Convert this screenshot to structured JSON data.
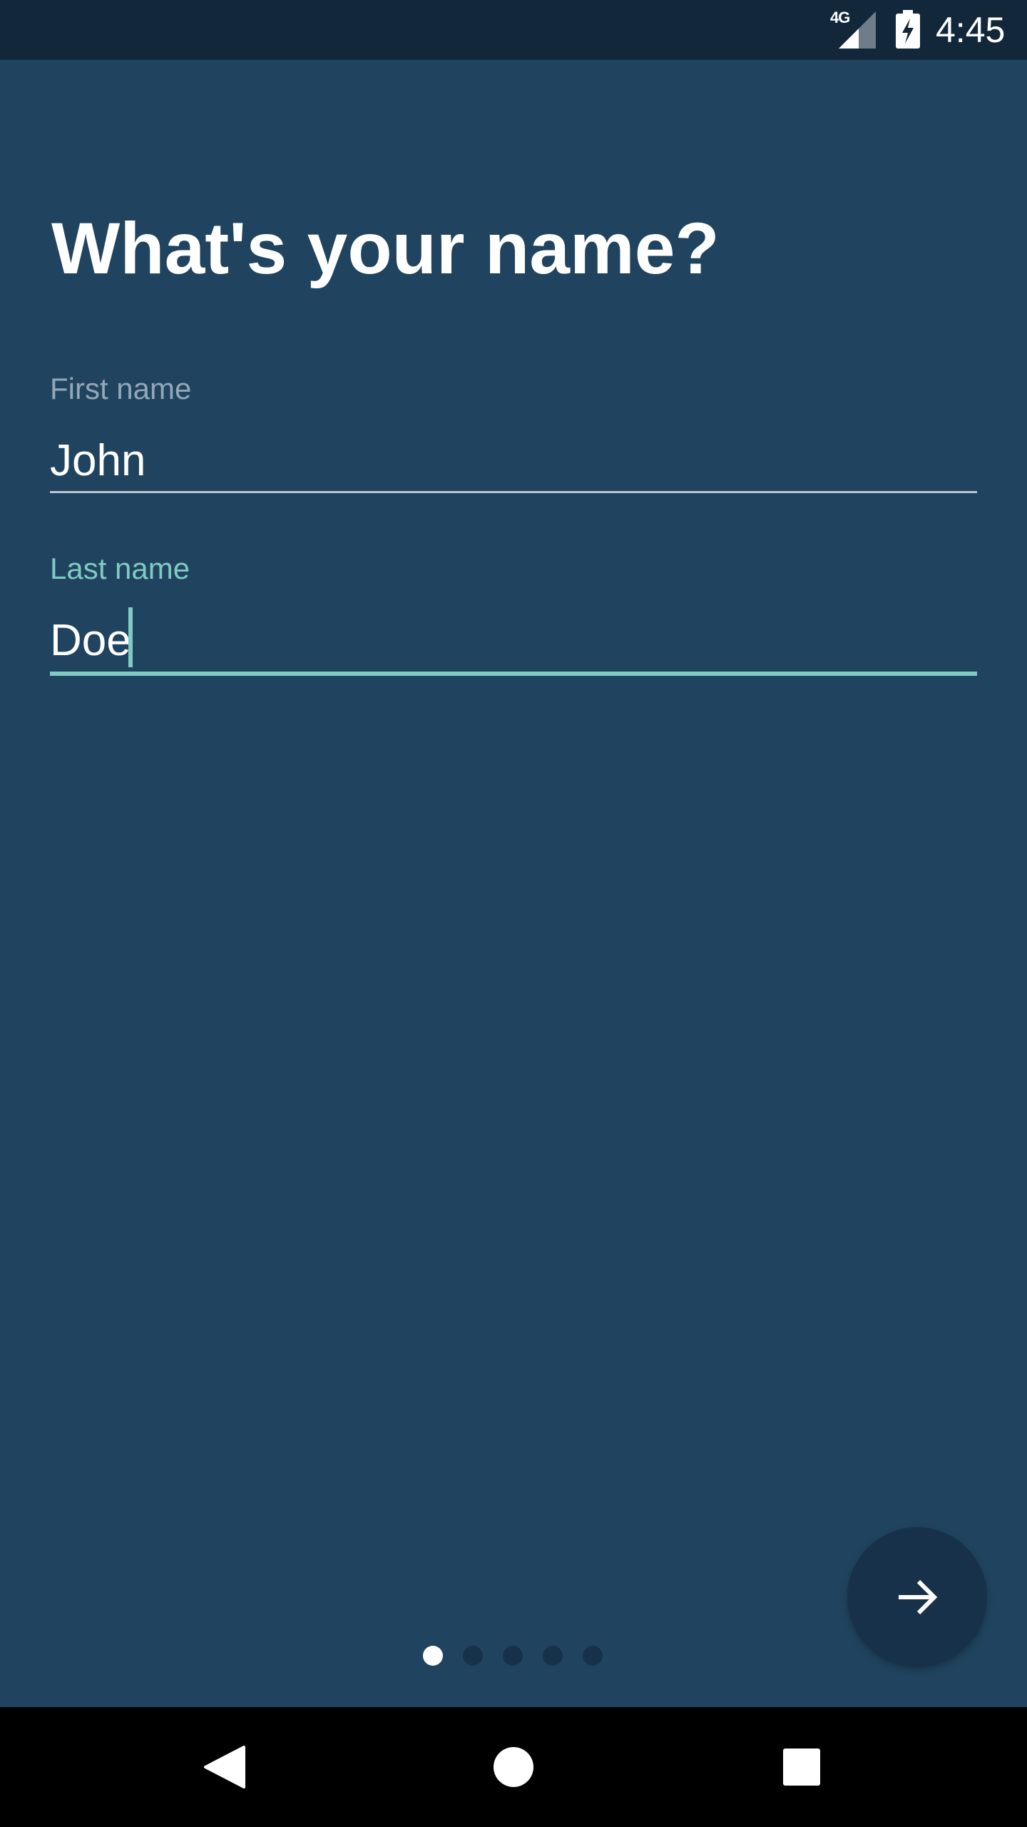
{
  "status_bar": {
    "network_label": "4G",
    "time": "4:45",
    "icons": [
      "signal-icon",
      "battery-charging-icon"
    ]
  },
  "screen": {
    "title": "What's your name?"
  },
  "form": {
    "first_name": {
      "label": "First name",
      "value": "John"
    },
    "last_name": {
      "label": "Last name",
      "value": "Doe"
    }
  },
  "fab": {
    "icon": "arrow-right-icon"
  },
  "pagination": {
    "total": 5,
    "current": 1
  },
  "nav_bar": {
    "icons": [
      "back-icon",
      "home-icon",
      "recents-icon"
    ]
  },
  "colors": {
    "background": "#20445F",
    "status_bar": "#13273A",
    "accent": "#7FCBC4",
    "fab": "#17314A",
    "inactive_label": "#93A7B7"
  }
}
